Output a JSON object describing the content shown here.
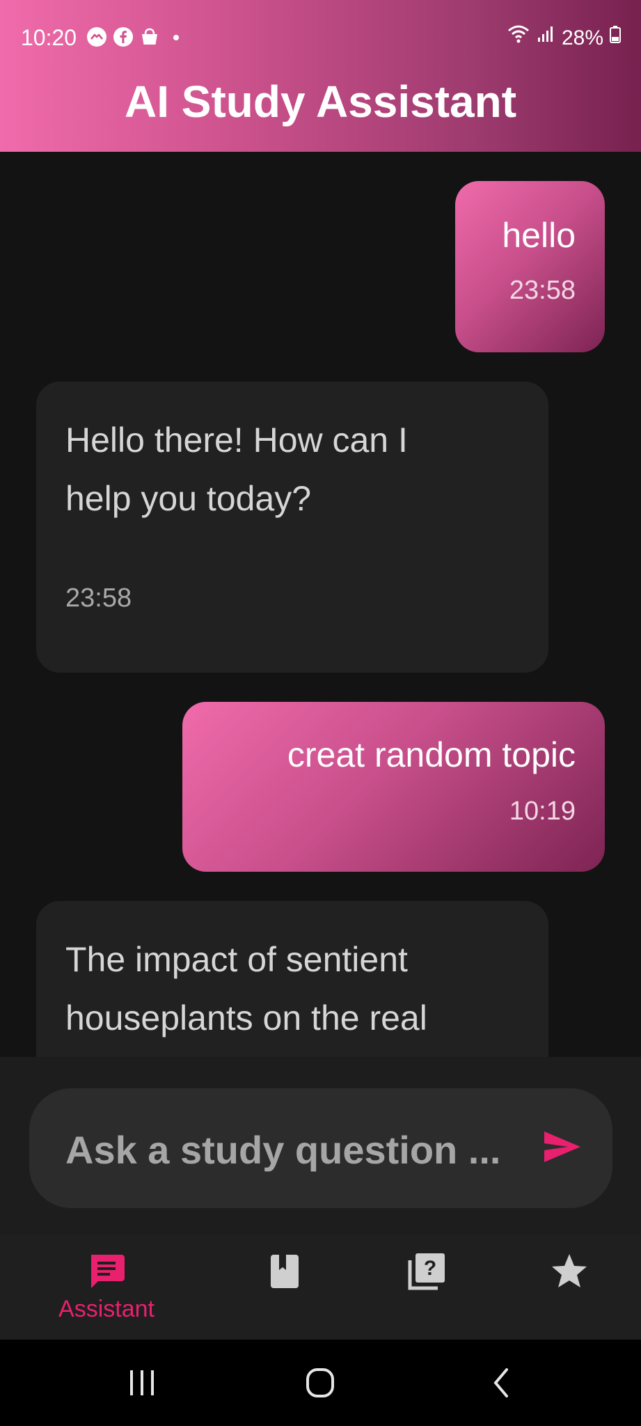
{
  "status_bar": {
    "time": "10:20",
    "battery": "28%",
    "left_icons": [
      "messenger-icon",
      "facebook-icon",
      "shopping-bag-icon",
      "notification-dot-icon"
    ],
    "right_icons": [
      "wifi-icon",
      "signal-icon",
      "battery-icon"
    ]
  },
  "app": {
    "title": "AI Study Assistant"
  },
  "messages": [
    {
      "role": "user",
      "text": "hello",
      "time": "23:58"
    },
    {
      "role": "assistant",
      "lines": [
        "Hello there! How can I",
        "help you today?"
      ],
      "time": "23:58"
    },
    {
      "role": "user",
      "text": "creat random topic",
      "time": "10:19"
    },
    {
      "role": "assistant",
      "lines": [
        "The impact of sentient",
        "houseplants on the real"
      ]
    }
  ],
  "composer": {
    "placeholder": "Ask a study question ...",
    "send_icon": "send-icon"
  },
  "bottom_nav": {
    "items": [
      {
        "label": "Assistant",
        "icon": "chat-icon",
        "active": true
      },
      {
        "label": "",
        "icon": "bookmark-book-icon",
        "active": false
      },
      {
        "label": "",
        "icon": "quiz-icon",
        "active": false
      },
      {
        "label": "",
        "icon": "star-icon",
        "active": false
      }
    ]
  },
  "colors": {
    "accent": "#e8206e",
    "user_bubble_start": "#f06bab",
    "user_bubble_end": "#7d2453",
    "bot_bubble": "#212121",
    "background": "#131313",
    "inactive_icon": "#cfcfcf"
  }
}
